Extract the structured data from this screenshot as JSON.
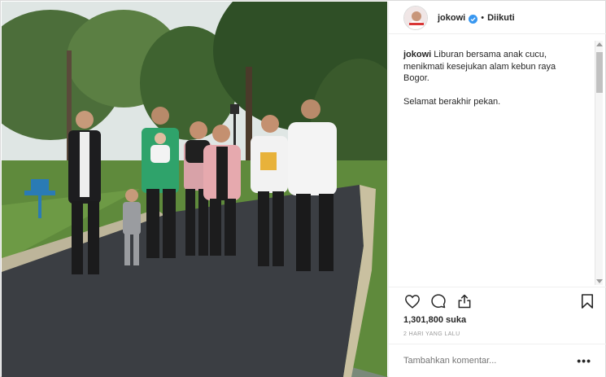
{
  "header": {
    "username": "jokowi",
    "separator": "•",
    "follow_status": "Diikuti",
    "verified_icon": "verified-badge-icon",
    "accent_color": "#3897f0"
  },
  "caption": {
    "username": "jokowi",
    "text": "Liburan bersama anak cucu, menikmati kesejukan alam kebun raya Bogor.",
    "second_paragraph": "Selamat berakhir pekan."
  },
  "actions": {
    "like_icon": "heart-icon",
    "comment_icon": "comment-icon",
    "share_icon": "share-icon",
    "save_icon": "bookmark-icon",
    "likes_count": "1,301,800",
    "likes_suffix": "suka",
    "timestamp": "2 HARI YANG LALU"
  },
  "comment": {
    "placeholder": "Tambahkan komentar...",
    "more_label": "•••"
  }
}
